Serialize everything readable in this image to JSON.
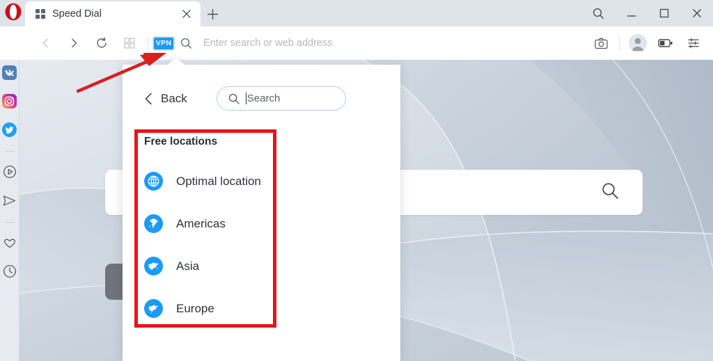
{
  "window": {
    "controls": [
      {
        "name": "window-search",
        "icon": "search-icon",
        "label": "Search"
      },
      {
        "name": "window-minimize",
        "icon": "minimize-icon",
        "label": "Minimize"
      },
      {
        "name": "window-maximize",
        "icon": "maximize-icon",
        "label": "Maximize"
      },
      {
        "name": "window-close",
        "icon": "close-icon",
        "label": "Close"
      }
    ]
  },
  "tabstrip": {
    "logo": "opera-logo",
    "tab": {
      "title": "Speed Dial",
      "favicon": "speed-dial-icon",
      "close_label": "×"
    },
    "new_tab_label": "+"
  },
  "toolbar": {
    "back": {
      "icon": "chevron-left-icon",
      "label": "Back"
    },
    "forward": {
      "icon": "chevron-right-icon",
      "label": "Forward"
    },
    "reload": {
      "icon": "reload-icon",
      "label": "Reload"
    },
    "tab_islands": {
      "icon": "grid-icon",
      "label": "Tab islands"
    },
    "vpn_badge": {
      "text": "VPN",
      "color": "#1b9af7",
      "background": "#d8dce1"
    },
    "address_search_icon": "search-icon",
    "address": {
      "value": "",
      "placeholder": "Enter search or web address"
    },
    "right_icons": [
      {
        "name": "snapshot-icon",
        "label": "Snapshot"
      },
      {
        "name": "profile-avatar",
        "label": "Profile"
      },
      {
        "name": "battery-saver-icon",
        "label": "Battery saver"
      },
      {
        "name": "easy-setup-icon",
        "label": "Easy setup"
      }
    ]
  },
  "sidebar": {
    "items": [
      {
        "name": "sidebar-item-vk",
        "label": "VK",
        "icon": "vk-icon"
      },
      {
        "name": "sidebar-item-instagram",
        "label": "Instagram",
        "icon": "instagram-icon"
      },
      {
        "name": "sidebar-item-twitter",
        "label": "Twitter",
        "icon": "twitter-icon"
      },
      {
        "name": "sidebar-item-player",
        "label": "Player",
        "icon": "player-icon"
      },
      {
        "name": "sidebar-item-messenger",
        "label": "Messenger",
        "icon": "send-icon"
      },
      {
        "name": "sidebar-item-favorites",
        "label": "Favorites",
        "icon": "heart-icon"
      },
      {
        "name": "sidebar-item-history",
        "label": "History",
        "icon": "clock-icon"
      }
    ]
  },
  "speeddial": {
    "search_icon": "search-icon",
    "search_value": "",
    "tile_label": ""
  },
  "vpn_panel": {
    "back_label": "Back",
    "back_icon": "chevron-left-icon",
    "search": {
      "icon": "search-icon",
      "value": "",
      "placeholder": "Search"
    },
    "section_title": "Free locations",
    "locations": [
      {
        "label": "Optimal location",
        "icon": "globe-icon"
      },
      {
        "label": "Americas",
        "icon": "globe-americas-icon"
      },
      {
        "label": "Asia",
        "icon": "globe-asia-icon"
      },
      {
        "label": "Europe",
        "icon": "globe-europe-icon"
      }
    ]
  },
  "annotations": {
    "highlight_color": "#e8141a",
    "arrow_color": "#d91f1f",
    "arrow_target": "vpn-badge",
    "highlight_target": "free-locations-list"
  }
}
